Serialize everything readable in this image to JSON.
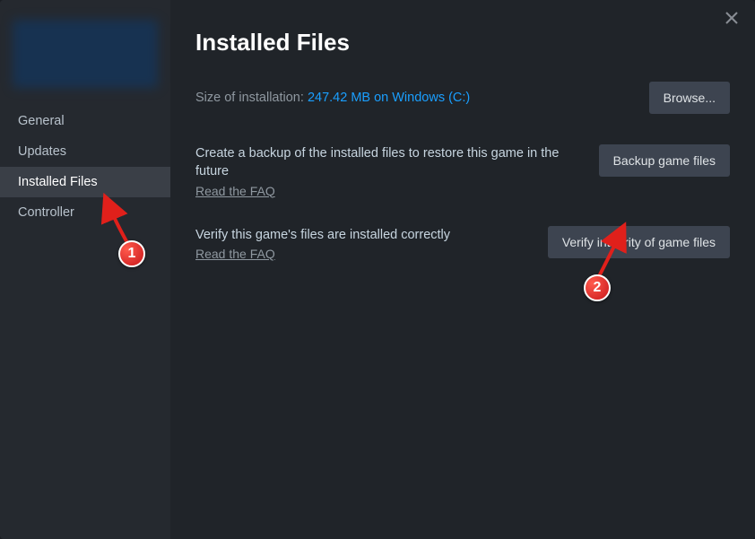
{
  "sidebar": {
    "items": [
      {
        "label": "General",
        "selected": false
      },
      {
        "label": "Updates",
        "selected": false
      },
      {
        "label": "Installed Files",
        "selected": true
      },
      {
        "label": "Controller",
        "selected": false
      }
    ]
  },
  "main": {
    "title": "Installed Files",
    "size_label": "Size of installation: ",
    "size_value": "247.42 MB on Windows (C:)",
    "browse_label": "Browse...",
    "backup": {
      "desc": "Create a backup of the installed files to restore this game in the future",
      "faq": "Read the FAQ",
      "btn": "Backup game files"
    },
    "verify": {
      "desc": "Verify this game's files are installed correctly",
      "faq": "Read the FAQ",
      "btn": "Verify integrity of game files"
    }
  },
  "annotations": {
    "badge1": "1",
    "badge2": "2"
  }
}
